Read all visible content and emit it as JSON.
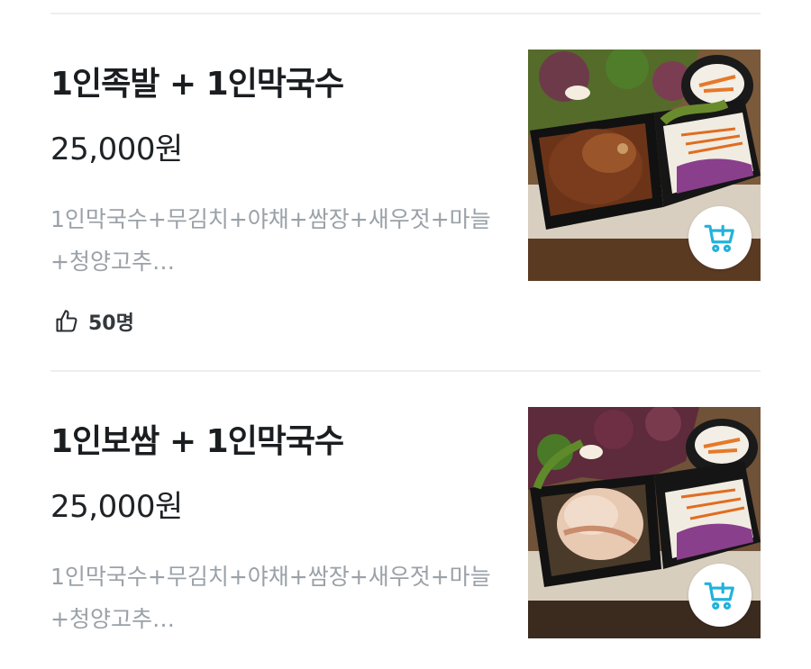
{
  "menu_items": [
    {
      "name": "1인족발 + 1인막국수",
      "price": "25,000원",
      "description": "1인막국수+무김치+야채+쌈장+새우젓+마늘+청양고추…",
      "likes": "50명"
    },
    {
      "name": "1인보쌈 + 1인막국수",
      "price": "25,000원",
      "description": "1인막국수+무김치+야채+쌈장+새우젓+마늘+청양고추…"
    }
  ],
  "icons": {
    "like": "thumbs-up-icon",
    "cart": "add-to-cart-icon"
  },
  "colors": {
    "accent": "#22b2dc",
    "description": "#9aa1a8",
    "divider": "#eceef0"
  }
}
